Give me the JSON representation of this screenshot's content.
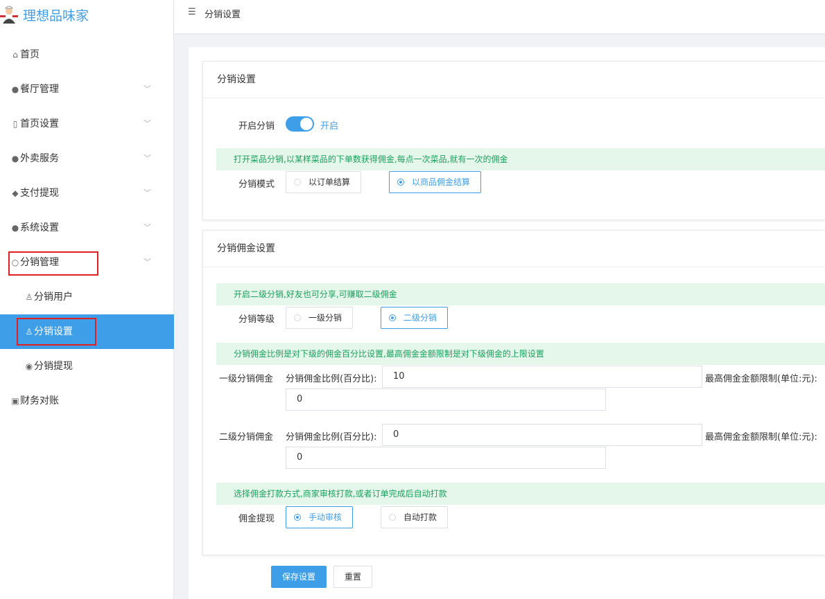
{
  "app": {
    "title": "理想品味家"
  },
  "colors": {
    "accent": "#3f9ee8",
    "tip_bg": "#e5f7ea",
    "tip_text": "#19a15e",
    "highlight_box": "#e02020"
  },
  "sidebar": {
    "items": [
      {
        "icon": "home-icon",
        "label": "首页"
      },
      {
        "icon": "user-icon",
        "label": "餐厅管理"
      },
      {
        "icon": "page-icon",
        "label": "首页设置"
      },
      {
        "icon": "user-icon",
        "label": "外卖服务"
      },
      {
        "icon": "shield-icon",
        "label": "支付提现"
      },
      {
        "icon": "user-icon",
        "label": "系统设置"
      },
      {
        "icon": "users-icon",
        "label": "分销管理"
      },
      {
        "icon": "person-icon",
        "label": "分销用户"
      },
      {
        "icon": "person-icon",
        "label": "分销设置",
        "active": true
      },
      {
        "icon": "coin-icon",
        "label": "分销提现"
      },
      {
        "icon": "ledger-icon",
        "label": "财务对账"
      }
    ]
  },
  "header": {
    "breadcrumb": "分销设置"
  },
  "card1": {
    "title": "分销设置",
    "enable_label": "开启分销",
    "enable_state": "开启",
    "tip": "打开菜品分销,以某样菜品的下单数获得佣金,每点一次菜品,就有一次的佣金",
    "mode_label": "分销模式",
    "mode_options": [
      "以订单结算",
      "以商品佣金结算"
    ],
    "mode_selected": "以商品佣金结算"
  },
  "card2": {
    "title": "分销佣金设置",
    "level_tip": "开启二级分销,好友也可分享,可赚取二级佣金",
    "level_label": "分销等级",
    "level_options": [
      "一级分销",
      "二级分销"
    ],
    "level_selected": "二级分销",
    "ratio_tip": "分销佣金比例是对下级的佣金百分比设置,最高佣金金额限制是对下级佣金的上限设置",
    "level1_label": "一级分销佣金",
    "level1_ratio_label": "分销佣金比例(百分比):",
    "level1_ratio_value": "10",
    "level1_max_label": "最高佣金金额限制(单位:元):",
    "level1_max_value": "0",
    "level2_label": "二级分销佣金",
    "level2_ratio_label": "分销佣金比例(百分比):",
    "level2_ratio_value": "0",
    "level2_max_label": "最高佣金金额限制(单位:元):",
    "level2_max_value": "0",
    "withdraw_tip": "选择佣金打款方式,商家审核打款,或者订单完成后自动打款",
    "withdraw_label": "佣金提现",
    "withdraw_options": [
      "手动审核",
      "自动打款"
    ],
    "withdraw_selected": "手动审核"
  },
  "actions": {
    "save": "保存设置",
    "reset": "重置"
  }
}
